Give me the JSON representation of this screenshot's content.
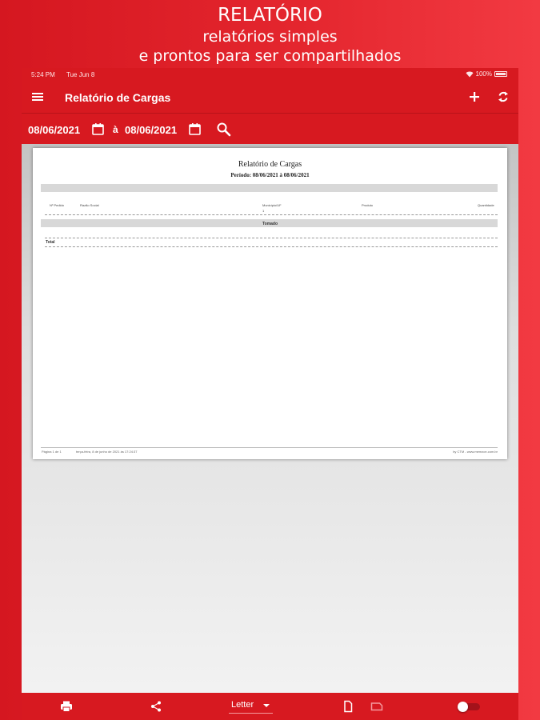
{
  "promo": {
    "title": "RELATÓRIO",
    "subtitle_line1": "relatórios simples",
    "subtitle_line2": "e prontos para ser compartilhados"
  },
  "status_bar": {
    "time": "5:24 PM",
    "date": "Tue Jun 8",
    "battery": "100%",
    "icons": [
      "wifi-icon",
      "battery-icon"
    ]
  },
  "app_bar": {
    "title": "Relatório de Cargas",
    "icons": [
      "menu-icon",
      "add-icon",
      "refresh-icon"
    ]
  },
  "filters": {
    "start_date": "08/06/2021",
    "separator": "à",
    "end_date": "08/06/2021",
    "icons": [
      "calendar-icon",
      "calendar-icon",
      "search-icon"
    ]
  },
  "report": {
    "title": "Relatório de Cargas",
    "period": "Período: 08/06/2021 à 08/06/2021",
    "columns": [
      "Nº Pedido",
      "Razão Social",
      "Município/UF",
      "Produto",
      "Quantidade"
    ],
    "marker": "1",
    "section_label": "Tomado",
    "total_label": "Total",
    "footer_page": "Página 1 de 1",
    "footer_date": "terça-feira, 8 de junho de 2021 às 17:24:37",
    "footer_brand": "by CTM - www.memzon.com.br"
  },
  "bottom_bar": {
    "paper_size": "Letter",
    "icons": [
      "print-icon",
      "share-icon",
      "portrait-icon",
      "landscape-icon",
      "toggle-switch"
    ]
  },
  "colors": {
    "brand_red": "#d71920",
    "preview_bg": "#dedede"
  }
}
